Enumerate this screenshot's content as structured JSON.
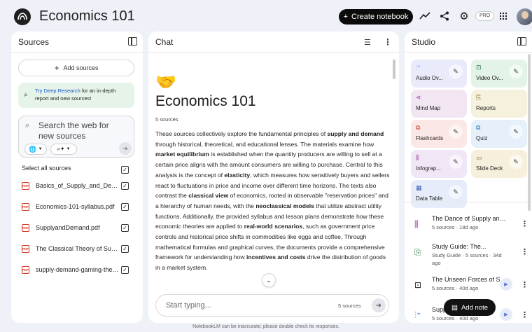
{
  "header": {
    "title": "Economics 101",
    "create_label": "Create notebook",
    "pro_label": "PRO"
  },
  "sources": {
    "title": "Sources",
    "add_label": "Add sources",
    "deep_research_link": "Try Deep Research",
    "deep_research_text": " for an in-depth report and new sources!",
    "web_search_placeholder": "Search the web for new sources",
    "select_all_label": "Select all sources",
    "items": [
      {
        "name": "Basics_of_Supply_and_Demand.pdf"
      },
      {
        "name": "Economics-101-syllabus.pdf"
      },
      {
        "name": "SupplyandDemand.pdf"
      },
      {
        "name": "The Classical Theory of Supply and Demand.pdf"
      },
      {
        "name": "supply-demand-gaming-theory.pdf"
      }
    ]
  },
  "chat": {
    "title": "Chat",
    "emoji": "🤝",
    "notebook_title": "Economics 101",
    "source_count": "5 sources",
    "input_placeholder": "Start typing...",
    "input_count": "5 sources",
    "summary": [
      {
        "t": "These sources collectively explore the fundamental principles of "
      },
      {
        "t": "supply and demand",
        "b": true
      },
      {
        "t": " through historical, theoretical, and educational lenses. The materials examine how "
      },
      {
        "t": "market equilibrium",
        "b": true
      },
      {
        "t": " is established when the quantity producers are willing to sell at a certain price aligns with the amount consumers are willing to purchase. Central to this analysis is the concept of "
      },
      {
        "t": "elasticity",
        "b": true
      },
      {
        "t": ", which measures how sensitively buyers and sellers react to fluctuations in price and income over different time horizons. The texts also contrast the "
      },
      {
        "t": "classical view",
        "b": true
      },
      {
        "t": " of economics, rooted in observable \"reservation prices\" and a hierarchy of human needs, with the "
      },
      {
        "t": "neoclassical models",
        "b": true
      },
      {
        "t": " that utilize abstract utility functions. Additionally, the provided syllabus and lesson plans demonstrate how these economic theories are applied to "
      },
      {
        "t": "real-world scenarios",
        "b": true
      },
      {
        "t": ", such as government price controls and historical price shifts in commodities like eggs and coffee. Through mathematical formulas and graphical curves, the documents provide a comprehensive framework for understanding how "
      },
      {
        "t": "incentives and costs",
        "b": true
      },
      {
        "t": " drive the distribution of goods in a market system."
      }
    ]
  },
  "studio": {
    "title": "Studio",
    "tiles": [
      {
        "label": "Audio Ov...",
        "icon": "audio-wave-icon",
        "color": "#e9ebfa",
        "icon_color": "#4b6fd8",
        "edit": true
      },
      {
        "label": "Video Ov...",
        "icon": "video-icon",
        "color": "#e3f3e7",
        "icon_color": "#2e7a45",
        "edit": true
      },
      {
        "label": "Mind Map",
        "icon": "mind-map-icon",
        "color": "#f3e6f3",
        "icon_color": "#8a3a92",
        "edit": false
      },
      {
        "label": "Reports",
        "icon": "reports-icon",
        "color": "#f5f1dd",
        "icon_color": "#7a6a2a",
        "edit": false
      },
      {
        "label": "Flashcards",
        "icon": "flashcards-icon",
        "color": "#fbe7e5",
        "icon_color": "#c0392b",
        "edit": true
      },
      {
        "label": "Quiz",
        "icon": "quiz-icon",
        "color": "#e5f0fa",
        "icon_color": "#2a6fb0",
        "edit": true
      },
      {
        "label": "Infograp...",
        "icon": "infographic-icon",
        "color": "#f1e6f6",
        "icon_color": "#8a3a92",
        "edit": true
      },
      {
        "label": "Slide Deck",
        "icon": "slide-deck-icon",
        "color": "#f6efdc",
        "icon_color": "#7a6a2a",
        "edit": true
      },
      {
        "label": "Data Table",
        "icon": "data-table-icon",
        "color": "#e7ecfa",
        "icon_color": "#3a5fb8",
        "edit": true
      }
    ],
    "notes": [
      {
        "title": "The Dance of Supply and Demand",
        "meta": "5 sources · 18d ago",
        "icon": "infographic-icon",
        "play": false
      },
      {
        "title": "Study Guide: The...",
        "meta": "Study Guide · 5 sources · 34d ago",
        "icon": "study-guide-icon",
        "play": false
      },
      {
        "title": "The Unseen Forces of Supply and Demand",
        "meta": "5 sources · 40d ago",
        "icon": "video-icon",
        "play": true
      },
      {
        "title": "Supply and Demand",
        "meta": "5 sources · 40d ago",
        "icon": "audio-wave-icon",
        "play": true
      }
    ],
    "add_note_label": "Add note"
  },
  "footer": "NotebookLM can be inaccurate; please double check its responses."
}
